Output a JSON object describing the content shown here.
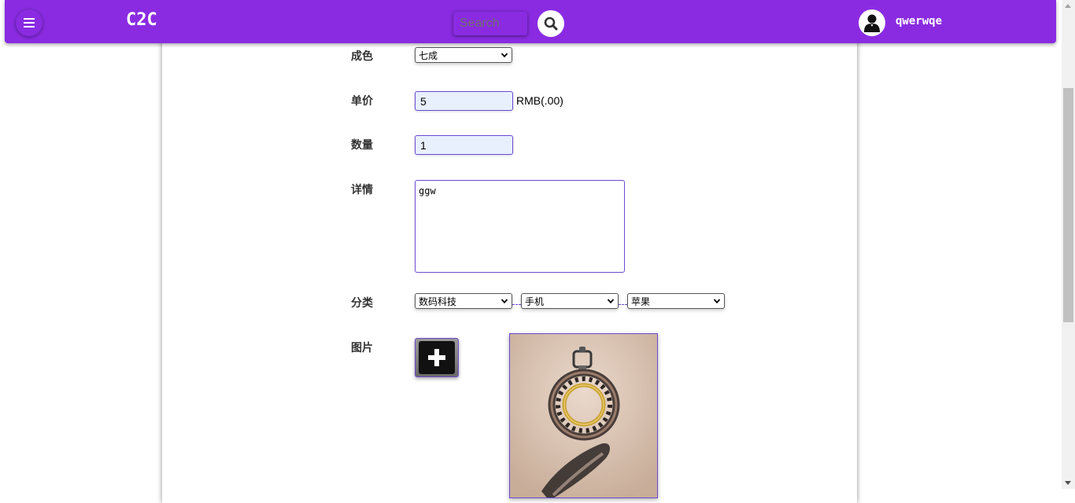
{
  "header": {
    "brand": "C2C",
    "search_placeholder": "Search",
    "username": "qwerwqe",
    "bg_color": "#8a2be2"
  },
  "icons": {
    "menu": "menu-icon",
    "search": "search-icon",
    "avatar": "user-icon",
    "add": "plus-icon"
  },
  "form": {
    "condition": {
      "label": "成色",
      "value": "七成"
    },
    "price": {
      "label": "单价",
      "value": "5",
      "unit": "RMB(.00)"
    },
    "quantity": {
      "label": "数量",
      "value": "1"
    },
    "details": {
      "label": "详情",
      "value": "ggw"
    },
    "category": {
      "label": "分类",
      "level1": "数码科技",
      "level2": "手机",
      "level3": "苹果"
    },
    "images": {
      "label": "图片"
    }
  }
}
